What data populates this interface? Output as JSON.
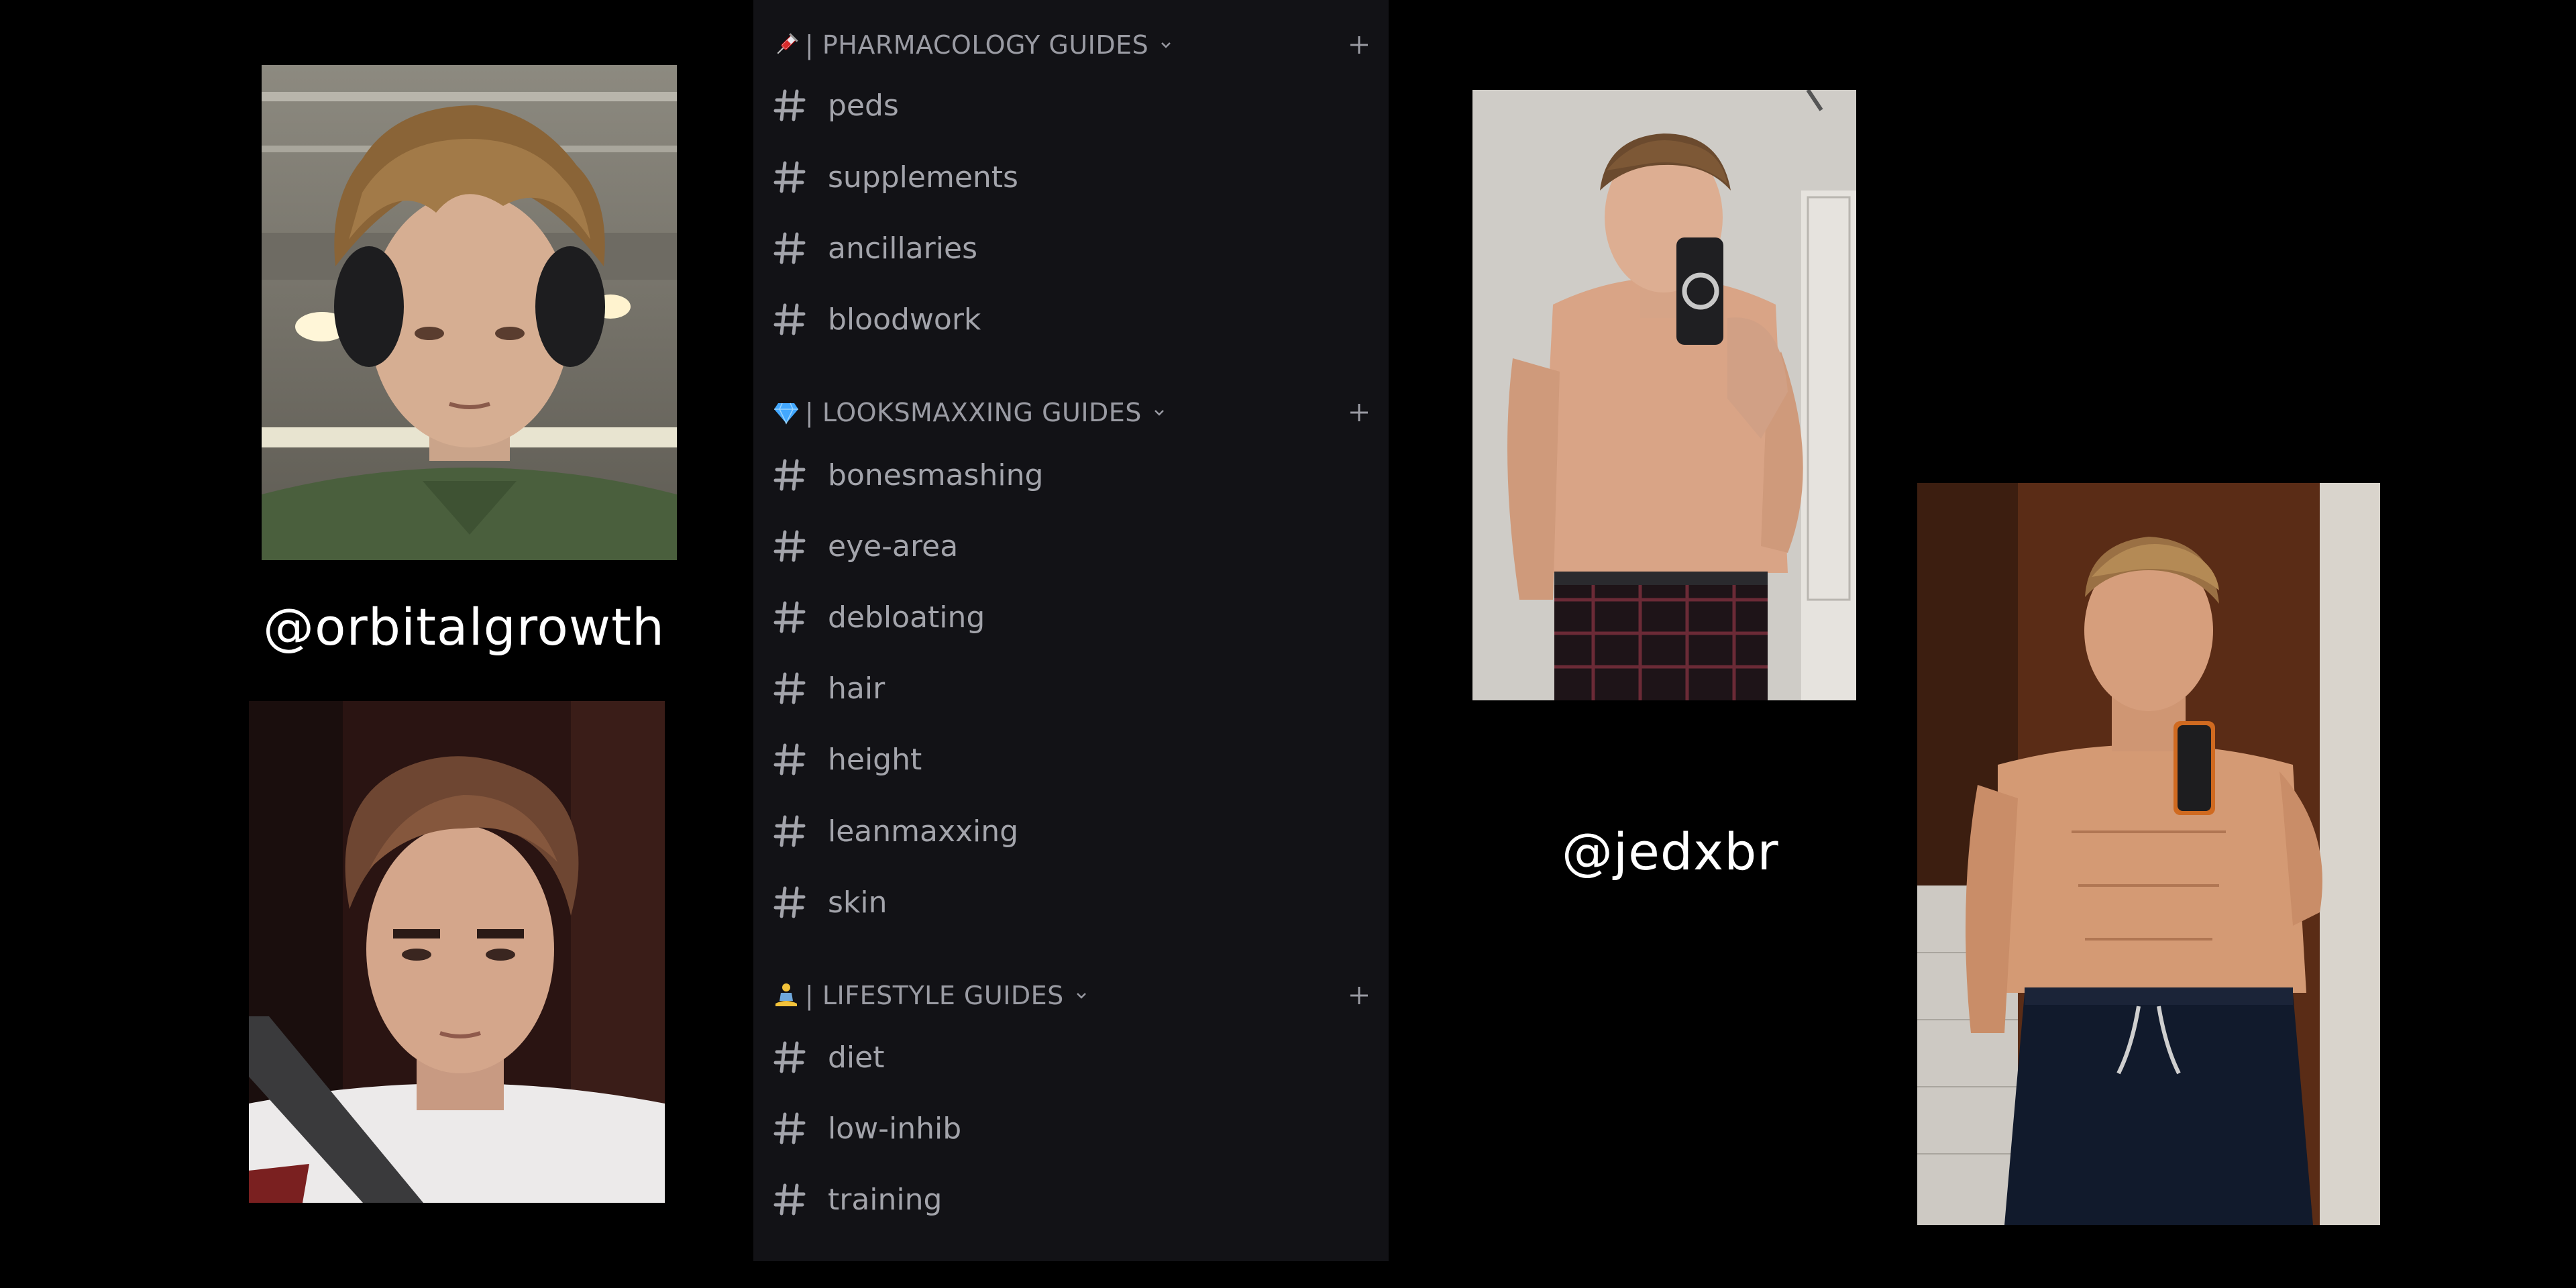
{
  "handles": {
    "left": "@orbitalgrowth",
    "right": "@jedxbr"
  },
  "sidebar": {
    "categories": [
      {
        "emoji_icon": "syringe-icon",
        "name": "| PHARMACOLOGY GUIDES",
        "channels": [
          "peds",
          "supplements",
          "ancillaries",
          "bloodwork"
        ]
      },
      {
        "emoji_icon": "gem-icon",
        "name": "| LOOKSMAXXING GUIDES",
        "channels": [
          "bonesmashing",
          "eye-area",
          "debloating",
          "hair",
          "height",
          "leanmaxxing",
          "skin"
        ]
      },
      {
        "emoji_icon": "meditating-person-icon",
        "name": "| LIFESTYLE GUIDES",
        "channels": [
          "diet",
          "low-inhib",
          "training"
        ]
      }
    ]
  },
  "colors": {
    "background": "#000000",
    "panel": "#121216",
    "channel_text": "#a3a4ab",
    "category_text": "#9a9ba3",
    "handle_text": "#ffffff"
  }
}
